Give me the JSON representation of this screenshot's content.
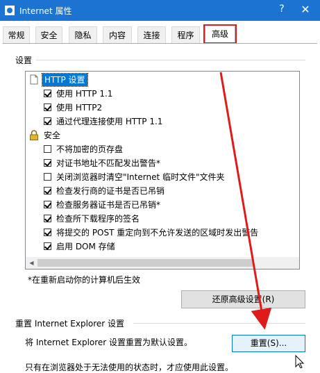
{
  "window": {
    "title": "Internet 属性",
    "help_glyph": "?",
    "close_glyph": "✕",
    "title_bar_color": "#1c73d1"
  },
  "tabs": [
    {
      "label": "常规"
    },
    {
      "label": "安全"
    },
    {
      "label": "隐私"
    },
    {
      "label": "内容"
    },
    {
      "label": "连接"
    },
    {
      "label": "程序"
    },
    {
      "label": "高级",
      "active": true
    }
  ],
  "settings": {
    "group_label": "设置",
    "items": [
      {
        "type": "header",
        "icon": "page-icon",
        "label": "HTTP 设置",
        "selected": true
      },
      {
        "type": "check",
        "checked": true,
        "label": "使用 HTTP 1.1"
      },
      {
        "type": "check",
        "checked": true,
        "label": "使用 HTTP2"
      },
      {
        "type": "check",
        "checked": true,
        "label": "通过代理连接使用 HTTP 1.1"
      },
      {
        "type": "header",
        "icon": "lock-icon",
        "label": "安全"
      },
      {
        "type": "check",
        "checked": false,
        "label": "不将加密的页存盘"
      },
      {
        "type": "check",
        "checked": true,
        "label": "对证书地址不匹配发出警告*"
      },
      {
        "type": "check",
        "checked": false,
        "label": "关闭浏览器时清空\"Internet 临时文件\"文件夹"
      },
      {
        "type": "check",
        "checked": true,
        "label": "检查发行商的证书是否已吊销"
      },
      {
        "type": "check",
        "checked": true,
        "label": "检查服务器证书是否已吊销*"
      },
      {
        "type": "check",
        "checked": true,
        "label": "检查所下载程序的签名"
      },
      {
        "type": "check",
        "checked": true,
        "label": "将提交的 POST 重定向到不允许发送的区域时发出警告"
      },
      {
        "type": "check",
        "checked": true,
        "label": "启用 DOM 存储"
      }
    ],
    "restart_note": "*在重新启动你的计算机后生效",
    "restore_button": "还原高级设置(R)"
  },
  "reset": {
    "group_label": "重置 Internet Explorer 设置",
    "description": "将 Internet Explorer 设置重置为默认设置。",
    "reset_button": "重置(S)...",
    "footer_text": "只有在浏览器处于无法使用的状态时，才应使用此设置。"
  },
  "annotation": {
    "color": "#e01a1a"
  }
}
